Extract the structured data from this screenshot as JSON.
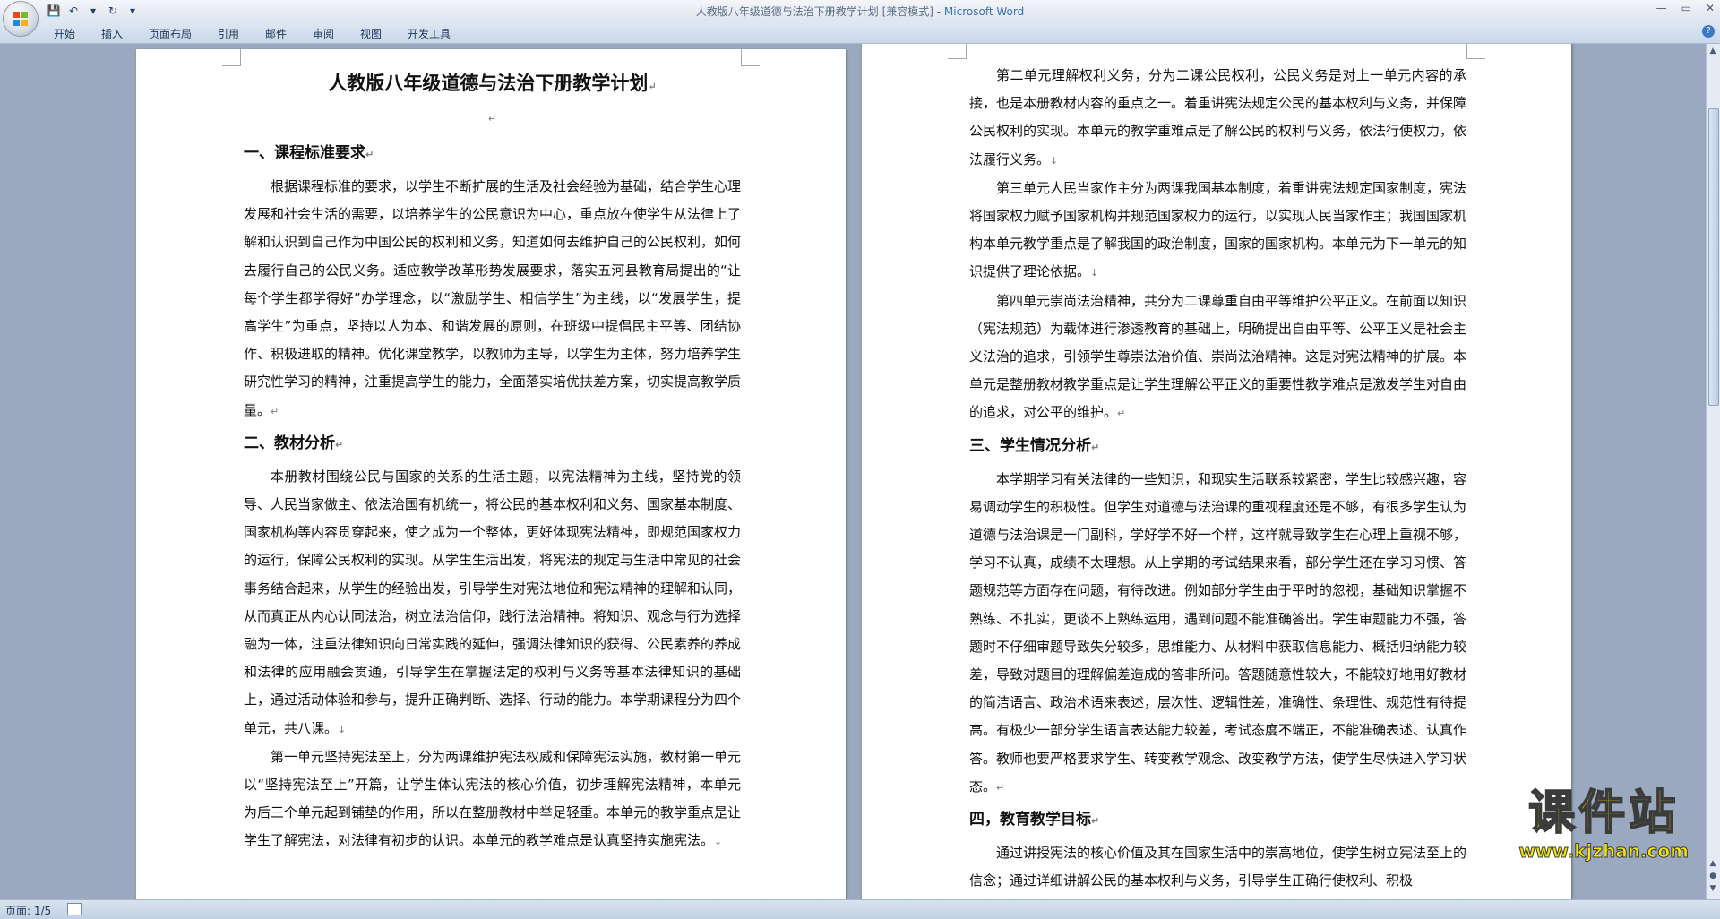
{
  "window": {
    "title": "人教版八年级道德与法治下册教学计划 [兼容模式] - ",
    "app_name": "Microsoft Word",
    "controls": [
      "—",
      "▭",
      "✕"
    ]
  },
  "quick_access": {
    "save": "💾",
    "undo": "↶",
    "undo_arrow": "▾",
    "redo": "↻",
    "customize": "▾"
  },
  "ribbon": {
    "tabs": [
      "开始",
      "插入",
      "页面布局",
      "引用",
      "邮件",
      "审阅",
      "视图",
      "开发工具"
    ],
    "help": "?"
  },
  "status": {
    "page": "页面: 1/5"
  },
  "watermark": {
    "text": "课件站",
    "url": "www.kjzhan.com"
  },
  "doc": {
    "title": "人教版八年级道德与法治下册教学计划",
    "mark": "↵",
    "down": "↓",
    "s1_heading": "一、课程标准要求",
    "s1_p1": "根据课程标准的要求，以学生不断扩展的生活及社会经验为基础，结合学生心理发展和社会生活的需要，以培养学生的公民意识为中心，重点放在使学生从法律上了解和认识到自己作为中国公民的权利和义务，知道如何去维护自己的公民权利，如何去履行自己的公民义务。适应教学改革形势发展要求，落实五河县教育局提出的“让每个学生都学得好”办学理念，以“激励学生、相信学生”为主线，以“发展学生，提高学生”为重点，坚持以人为本、和谐发展的原则，在班级中提倡民主平等、团结协作、积极进取的精神。优化课堂教学，以教师为主导，以学生为主体，努力培养学生研究性学习的精神，注重提高学生的能力，全面落实培优扶差方案，切实提高教学质量。",
    "s2_heading": "二、教材分析",
    "s2_p1": "本册教材围绕公民与国家的关系的生活主题，以宪法精神为主线，坚持党的领导、人民当家做主、依法治国有机统一，将公民的基本权利和义务、国家基本制度、国家机构等内容贯穿起来，使之成为一个整体，更好体现宪法精神，即规范国家权力的运行，保障公民权利的实现。从学生生活出发，将宪法的规定与生活中常见的社会事务结合起来，从学生的经验出发，引导学生对宪法地位和宪法精神的理解和认同，从而真正从内心认同法治，树立法治信仰，践行法治精神。将知识、观念与行为选择融为一体，注重法律知识向日常实践的延伸，强调法律知识的获得、公民素养的养成和法律的应用融会贯通，引导学生在掌握法定的权利与义务等基本法律知识的基础上，通过活动体验和参与，提升正确判断、选择、行动的能力。本学期课程分为四个单元，共八课。",
    "s2_p2": "第一单元坚持宪法至上，分为两课维护宪法权威和保障宪法实施，教材第一单元以“坚持宪法至上”开篇，让学生体认宪法的核心价值，初步理解宪法精神，本单元为后三个单元起到铺垫的作用，所以在整册教材中举足轻重。本单元的教学重点是让学生了解宪法，对法律有初步的认识。本单元的教学难点是认真坚持实施宪法。",
    "p2_p1": "第二单元理解权利义务，分为二课公民权利，公民义务是对上一单元内容的承接，也是本册教材内容的重点之一。着重讲宪法规定公民的基本权利与义务，并保障公民权利的实现。本单元的教学重难点是了解公民的权利与义务，依法行使权力，依法履行义务。",
    "p2_p2": "第三单元人民当家作主分为两课我国基本制度，着重讲宪法规定国家制度，宪法将国家权力赋予国家机构并规范国家权力的运行，以实现人民当家作主；我国国家机构本单元教学重点是了解我国的政治制度，国家的国家机构。本单元为下一单元的知识提供了理论依据。",
    "p2_p3": "第四单元崇尚法治精神，共分为二课尊重自由平等维护公平正义。在前面以知识（宪法规范）为载体进行渗透教育的基础上，明确提出自由平等、公平正义是社会主义法治的追求，引领学生尊崇法治价值、崇尚法治精神。这是对宪法精神的扩展。本单元是整册教材教学重点是让学生理解公平正义的重要性教学难点是激发学生对自由的追求，对公平的维护。",
    "s3_heading": "三、学生情况分析",
    "s3_p1": "本学期学习有关法律的一些知识，和现实生活联系较紧密，学生比较感兴趣，容易调动学生的积极性。但学生对道德与法治课的重视程度还是不够，有很多学生认为道德与法治课是一门副科，学好学不好一个样，这样就导致学生在心理上重视不够，学习不认真，成绩不太理想。从上学期的考试结果来看，部分学生还在学习习惯、答题规范等方面存在问题，有待改进。例如部分学生由于平时的忽视，基础知识掌握不熟练、不扎实，更谈不上熟练运用，遇到问题不能准确答出。学生审题能力不强，答题时不仔细审题导致失分较多，思维能力、从材料中获取信息能力、概括归纳能力较差，导致对题目的理解偏差造成的答非所问。答题随意性较大，不能较好地用好教材的简洁语言、政治术语来表述，层次性、逻辑性差，准确性、条理性、规范性有待提高。有极少一部分学生语言表达能力较差，考试态度不端正，不能准确表述、认真作答。教师也要严格要求学生、转变教学观念、改变教学方法，使学生尽快进入学习状态。",
    "s4_heading": "四，教育教学目标",
    "s4_p1": "通过讲授宪法的核心价值及其在国家生活中的崇高地位，使学生树立宪法至上的信念；通过详细讲解公民的基本权利与义务，引导学生正确行使权利、积极"
  }
}
